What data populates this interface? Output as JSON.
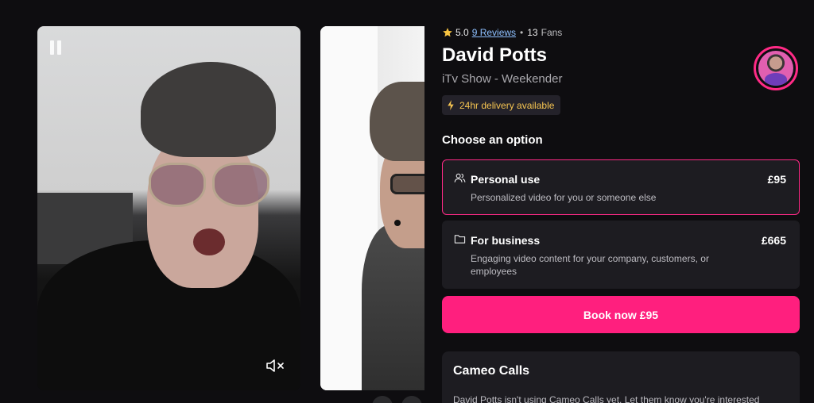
{
  "videos": [
    {
      "pause_icon": "pause-icon",
      "mute_icon": "speaker-muted-icon"
    },
    {}
  ],
  "talent": {
    "rating": "5.0",
    "reviews": "9 Reviews",
    "separator": "•",
    "fans_count": "13",
    "fans_label": "Fans",
    "name": "David Potts",
    "subtitle": "iTv Show - Weekender",
    "delivery_badge": "24hr delivery available"
  },
  "options": {
    "heading": "Choose an option",
    "items": [
      {
        "icon": "people-icon",
        "title": "Personal use",
        "price": "£95",
        "description": "Personalized video for you or someone else",
        "selected": true
      },
      {
        "icon": "folder-icon",
        "title": "For business",
        "price": "£665",
        "description": "Engaging video content for your company, customers, or employees",
        "selected": false
      }
    ]
  },
  "book_button": "Book now £95",
  "cameo_calls": {
    "title": "Cameo Calls",
    "text": "David Potts isn't using Cameo Calls yet. Let them know you're interested"
  },
  "colors": {
    "accent": "#ff1f7e",
    "badge_text": "#f5c451",
    "link": "#8ec0ff",
    "background": "#0e0d10",
    "card": "#1d1c21"
  }
}
